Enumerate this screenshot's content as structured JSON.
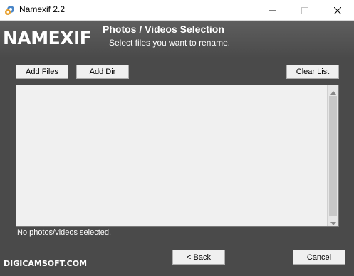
{
  "window": {
    "title": "Namexif 2.2"
  },
  "header": {
    "logo": "NAMEXIF",
    "title": "Photos / Videos Selection",
    "subtitle": "Select files you want to rename."
  },
  "toolbar": {
    "add_files_label": "Add Files",
    "add_dir_label": "Add Dir",
    "clear_list_label": "Clear List"
  },
  "file_list": {
    "items": [],
    "status": "No photos/videos selected."
  },
  "footer": {
    "brand": "DIGICAMSOFT.COM",
    "back_label": "< Back",
    "cancel_label": "Cancel"
  },
  "icons": {
    "app": "app-gear-icon",
    "minimize": "minimize-icon",
    "maximize": "maximize-icon",
    "close": "close-icon",
    "scroll_up": "scroll-up-arrow-icon",
    "scroll_down": "scroll-down-arrow-icon"
  }
}
